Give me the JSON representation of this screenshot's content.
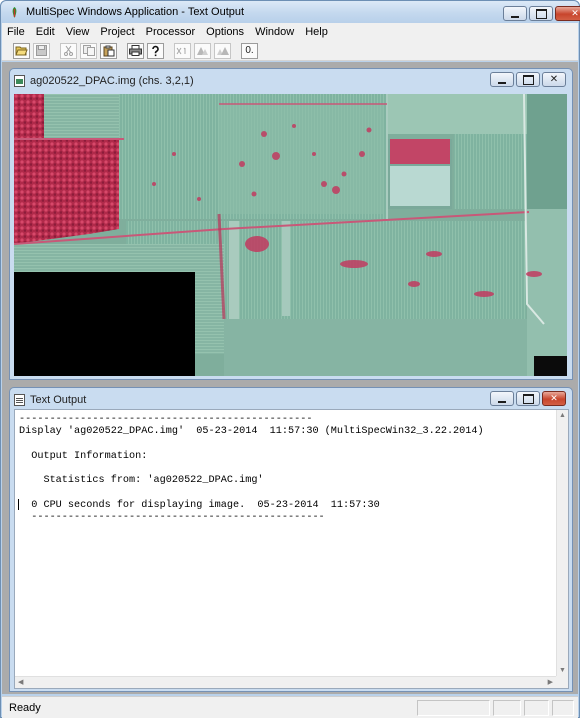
{
  "app": {
    "title": "MultiSpec Windows Application - Text Output"
  },
  "menu": [
    "File",
    "Edit",
    "View",
    "Project",
    "Processor",
    "Options",
    "Window",
    "Help"
  ],
  "toolbar": {
    "buttons": [
      {
        "name": "open",
        "icon": "folder-open-icon"
      },
      {
        "name": "save",
        "icon": "save-icon"
      },
      {
        "name": "cut",
        "icon": "scissors-icon"
      },
      {
        "name": "copy",
        "icon": "copy-icon"
      },
      {
        "name": "paste",
        "icon": "paste-icon"
      },
      {
        "name": "print",
        "icon": "printer-icon"
      },
      {
        "name": "help",
        "icon": "help-icon"
      },
      {
        "name": "zoom-x1",
        "icon": "zoom-x1-icon"
      },
      {
        "name": "zoom-in",
        "icon": "zoom-in-icon"
      },
      {
        "name": "zoom-out",
        "icon": "zoom-out-icon"
      },
      {
        "name": "overlay",
        "icon": "overlay-icon"
      }
    ],
    "overlay_label": "0."
  },
  "image_window": {
    "title": "ag020522_DPAC.img (chs. 3,2,1)",
    "icon": "image-window-icon"
  },
  "text_window": {
    "title": "Text Output",
    "icon": "text-window-icon",
    "lines": [
      "------------------------------------------------",
      "Display 'ag020522_DPAC.img'  05-23-2014  11:57:30 (MultiSpecWin32_3.22.2014)",
      "",
      "  Output Information:",
      "",
      "    Statistics from: 'ag020522_DPAC.img'",
      "",
      "  0 CPU seconds for displaying image.  05-23-2014  11:57:30",
      "  ------------------------------------------------"
    ]
  },
  "status": {
    "text": "Ready"
  },
  "colors": {
    "frame": "#b9d1ea",
    "mdi_background": "#ababab",
    "close_button": "#c8452c"
  }
}
